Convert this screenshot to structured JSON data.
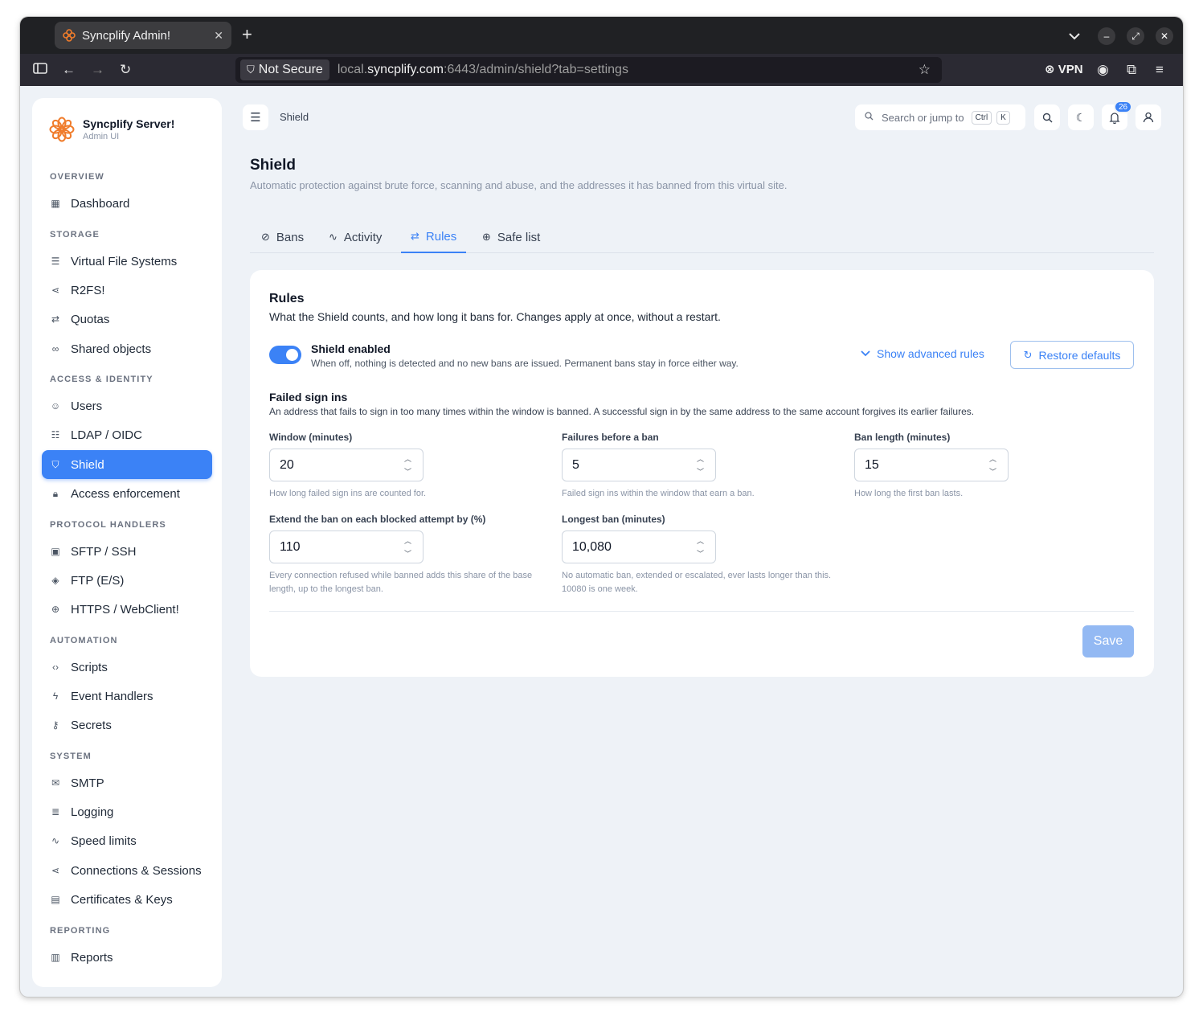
{
  "browser": {
    "tab_title": "Syncplify Admin!",
    "security_label": "Not Secure",
    "url_prefix": "local.",
    "url_host": "syncplify.com",
    "url_rest": ":6443/admin/shield?tab=settings",
    "vpn_label": "VPN"
  },
  "brand": {
    "title": "Syncplify Server!",
    "subtitle": "Admin UI"
  },
  "sidebar": {
    "overview": "OVERVIEW",
    "dashboard": "Dashboard",
    "storage": "STORAGE",
    "vfs": "Virtual File Systems",
    "r2fs": "R2FS!",
    "quotas": "Quotas",
    "shared": "Shared objects",
    "access": "ACCESS & IDENTITY",
    "users": "Users",
    "ldap": "LDAP / OIDC",
    "shield": "Shield",
    "enforcement": "Access enforcement",
    "protocol": "PROTOCOL HANDLERS",
    "sftp": "SFTP / SSH",
    "ftp": "FTP (E/S)",
    "https": "HTTPS / WebClient!",
    "automation": "AUTOMATION",
    "scripts": "Scripts",
    "events": "Event Handlers",
    "secrets": "Secrets",
    "system": "SYSTEM",
    "smtp": "SMTP",
    "logging": "Logging",
    "speed": "Speed limits",
    "connections": "Connections & Sessions",
    "certs": "Certificates & Keys",
    "reporting": "REPORTING",
    "reports": "Reports"
  },
  "header": {
    "breadcrumb": "Shield",
    "search_placeholder": "Search or jump to",
    "kbd_ctrl": "Ctrl",
    "kbd_k": "K",
    "notification_count": "26"
  },
  "page": {
    "title": "Shield",
    "subtitle": "Automatic protection against brute force, scanning and abuse, and the addresses it has banned from this virtual site.",
    "tabs": {
      "bans": "Bans",
      "activity": "Activity",
      "rules": "Rules",
      "safelist": "Safe list"
    }
  },
  "rules": {
    "title": "Rules",
    "subtitle": "What the Shield counts, and how long it bans for. Changes apply at once, without a restart.",
    "toggle_label": "Shield enabled",
    "toggle_desc": "When off, nothing is detected and no new bans are issued. Permanent bans stay in force either way.",
    "shield_enabled": true,
    "advanced_label": "Show advanced rules",
    "restore_label": "Restore defaults",
    "group_title": "Failed sign ins",
    "group_desc": "An address that fails to sign in too many times within the window is banned. A successful sign in by the same address to the same account forgives its earlier failures.",
    "window": {
      "label": "Window (minutes)",
      "value": "20",
      "help": "How long failed sign ins are counted for."
    },
    "failures": {
      "label": "Failures before a ban",
      "value": "5",
      "help": "Failed sign ins within the window that earn a ban."
    },
    "ban_length": {
      "label": "Ban length (minutes)",
      "value": "15",
      "help": "How long the first ban lasts."
    },
    "extend": {
      "label": "Extend the ban on each blocked attempt by (%)",
      "value": "110",
      "help": "Every connection refused while banned adds this share of the base length, up to the longest ban."
    },
    "longest": {
      "label": "Longest ban (minutes)",
      "value": "10,080",
      "help": "No automatic ban, extended or escalated, ever lasts longer than this. 10080 is one week."
    },
    "save_label": "Save"
  },
  "colors": {
    "accent": "#3b82f6",
    "save_disabled": "#93b9f3",
    "brand_orange": "#f07c2b"
  }
}
